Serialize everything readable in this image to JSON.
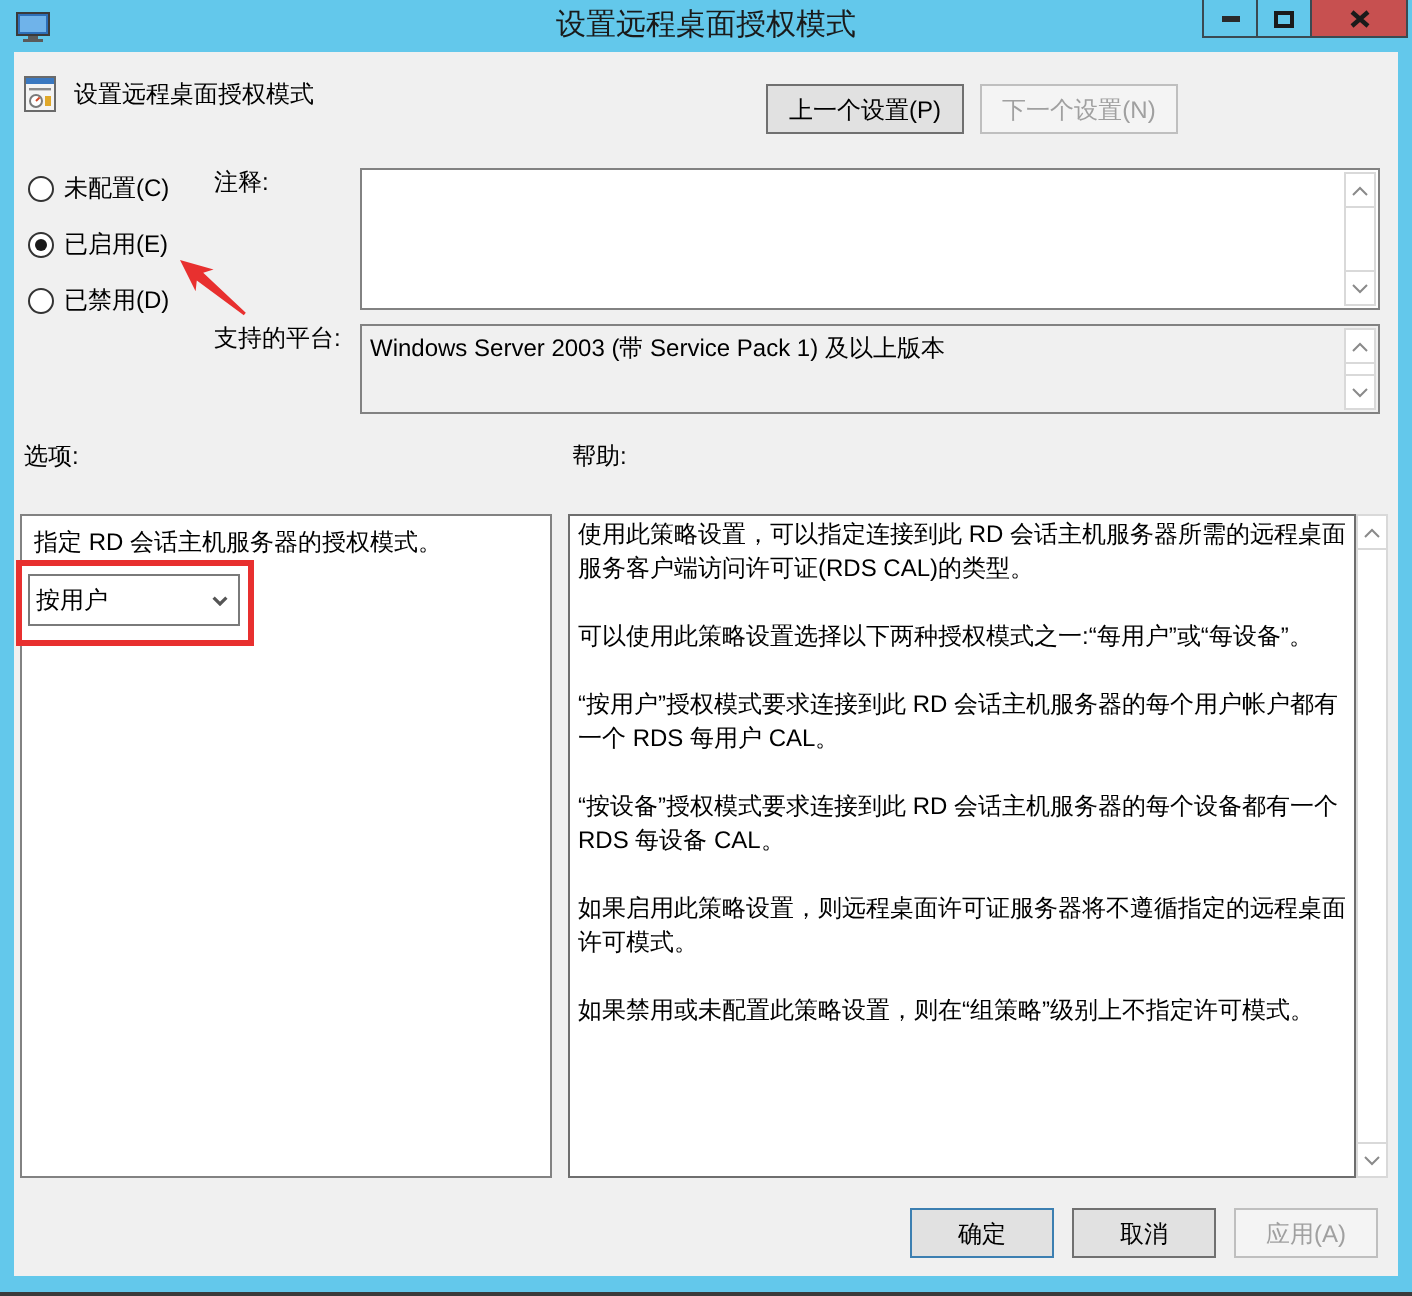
{
  "window": {
    "title": "设置远程桌面授权模式"
  },
  "header": {
    "title": "设置远程桌面授权模式",
    "buttons": [
      {
        "label": "上一个设置(P)",
        "disabled": false
      },
      {
        "label": "下一个设置(N)",
        "disabled": true
      }
    ]
  },
  "state_options": [
    {
      "label": "未配置(C)",
      "selected": false
    },
    {
      "label": "已启用(E)",
      "selected": true
    },
    {
      "label": "已禁用(D)",
      "selected": false
    }
  ],
  "comment": {
    "label": "注释:"
  },
  "platform": {
    "label": "支持的平台:",
    "value": "Windows Server 2003 (带 Service Pack 1) 及以上版本"
  },
  "options": {
    "label": "选项:",
    "description": "指定 RD 会话主机服务器的授权模式。",
    "dropdown": {
      "value": "按用户"
    }
  },
  "help": {
    "label": "帮助:",
    "paragraphs": [
      "使用此策略设置，可以指定连接到此 RD 会话主机服务器所需的远程桌面服务客户端访问许可证(RDS CAL)的类型。",
      "可以使用此策略设置选择以下两种授权模式之一:“每用户”或“每设备”。",
      "“按用户”授权模式要求连接到此 RD 会话主机服务器的每个用户帐户都有一个 RDS 每用户 CAL。",
      "“按设备”授权模式要求连接到此 RD 会话主机服务器的每个设备都有一个 RDS 每设备 CAL。",
      "如果启用此策略设置，则远程桌面许可证服务器将不遵循指定的远程桌面许可模式。",
      "如果禁用或未配置此策略设置，则在“组策略”级别上不指定许可模式。"
    ]
  },
  "footer_buttons": [
    {
      "label": "确定",
      "default": true,
      "disabled": false
    },
    {
      "label": "取消",
      "default": false,
      "disabled": false
    },
    {
      "label": "应用(A)",
      "default": false,
      "disabled": true
    }
  ]
}
